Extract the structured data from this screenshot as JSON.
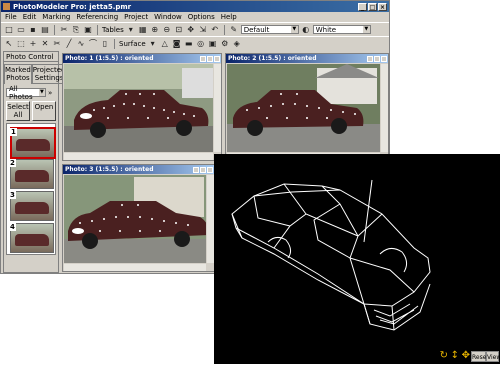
{
  "window": {
    "title": "PhotoModeler Pro: jetta5.pmr",
    "controls": [
      "_",
      "□",
      "×"
    ]
  },
  "menu": [
    "File",
    "Edit",
    "Marking",
    "Referencing",
    "Project",
    "Window",
    "Options",
    "Help"
  ],
  "toolbar1": {
    "tables_label": "Tables",
    "combo_default": "Default",
    "combo_white": "White"
  },
  "toolbar2": {
    "surface_label": "Surface"
  },
  "photo_control": {
    "title": "Photo Control",
    "tab_marked": "Marked Photos",
    "tab_projected": "Projected Settings",
    "filter_value": "All Photos",
    "select_all": "Select All",
    "open": "Open",
    "thumb_numbers": [
      "1",
      "2",
      "3",
      "4"
    ]
  },
  "photos": [
    {
      "title": "Photo: 1 (1:5.5) : oriented"
    },
    {
      "title": "Photo: 2 (1:5.5) : oriented"
    },
    {
      "title": "Photo: 3 (1:5.5) : oriented"
    }
  ],
  "wireframe": {
    "btn_reset": "Reset",
    "btn_view": "View"
  },
  "colors": {
    "titlebar": "#0a246a",
    "car": "#5a2a2a",
    "wire_bg": "#000000",
    "wire_line": "#ffffff",
    "nav_icon": "#e8b400"
  }
}
